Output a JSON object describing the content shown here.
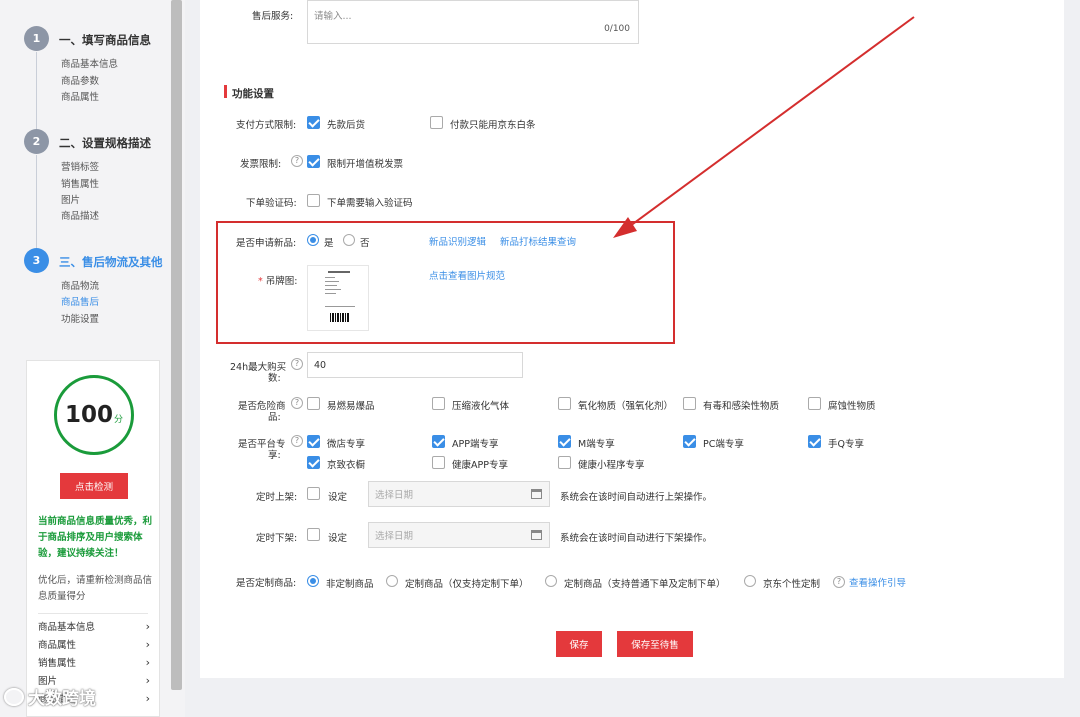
{
  "sidebar": {
    "steps": [
      {
        "num": "1",
        "title": "一、填写商品信息",
        "subs": [
          "商品基本信息",
          "商品参数",
          "商品属性"
        ]
      },
      {
        "num": "2",
        "title": "二、设置规格描述",
        "subs": [
          "营销标签",
          "销售属性",
          "图片",
          "商品描述"
        ]
      },
      {
        "num": "3",
        "title": "三、售后物流及其他",
        "subs": [
          "商品物流",
          "商品售后",
          "功能设置"
        ]
      }
    ],
    "quality": {
      "score": "100",
      "unit": "分",
      "check_label": "点击检测",
      "green_text": "当前商品信息质量优秀，利于商品排序及用户搜索体验，建议持续关注！",
      "gray_text": "优化后，请重新检测商品信息质量得分",
      "links": [
        "商品基本信息",
        "商品属性",
        "销售属性",
        "图片",
        "商品描述"
      ]
    }
  },
  "after_sale": {
    "label": "售后服务:",
    "placeholder": "请输入...",
    "counter": "0/100"
  },
  "section_title": "功能设置",
  "payment": {
    "label": "支付方式限制:",
    "opt1": "先款后货",
    "opt2": "付款只能用京东白条"
  },
  "invoice": {
    "label": "发票限制:",
    "opt": "限制开增值税发票"
  },
  "captcha": {
    "label": "下单验证码:",
    "opt": "下单需要输入验证码"
  },
  "new_product": {
    "label": "是否申请新品:",
    "yes": "是",
    "no": "否",
    "link1": "新品识别逻辑",
    "link2": "新品打标结果查询"
  },
  "tag_image": {
    "label": "吊牌图:",
    "link": "点击查看图片规范"
  },
  "max_buy": {
    "label1": "24h最大购买",
    "label2": "数:",
    "value": "40"
  },
  "danger": {
    "label1": "是否危险商",
    "label2": "品:",
    "opts": [
      "易燃易爆品",
      "压缩液化气体",
      "氧化物质（强氧化剂）",
      "有毒和感染性物质",
      "腐蚀性物质"
    ]
  },
  "platform": {
    "label1": "是否平台专",
    "label2": "享:",
    "opts": [
      "微店专享",
      "APP端专享",
      "M端专享",
      "PC端专享",
      "手Q专享",
      "京致衣橱",
      "健康APP专享",
      "健康小程序专享"
    ]
  },
  "timed_on": {
    "label": "定时上架:",
    "opt": "设定",
    "placeholder": "选择日期",
    "note": "系统会在该时间自动进行上架操作。"
  },
  "timed_off": {
    "label": "定时下架:",
    "opt": "设定",
    "placeholder": "选择日期",
    "note": "系统会在该时间自动进行下架操作。"
  },
  "custom": {
    "label": "是否定制商品:",
    "opts": [
      "非定制商品",
      "定制商品（仅支持定制下单）",
      "定制商品（支持普通下单及定制下单）",
      "京东个性定制"
    ],
    "guide": "查看操作引导"
  },
  "buttons": {
    "save": "保存",
    "save_pending": "保存至待售"
  },
  "watermark": "大数跨境",
  "colors": {
    "accent": "#3a8ee6",
    "primary_red": "#e4393c",
    "highlight_red": "#d42e2e",
    "quality_green": "#1a9b3a"
  }
}
